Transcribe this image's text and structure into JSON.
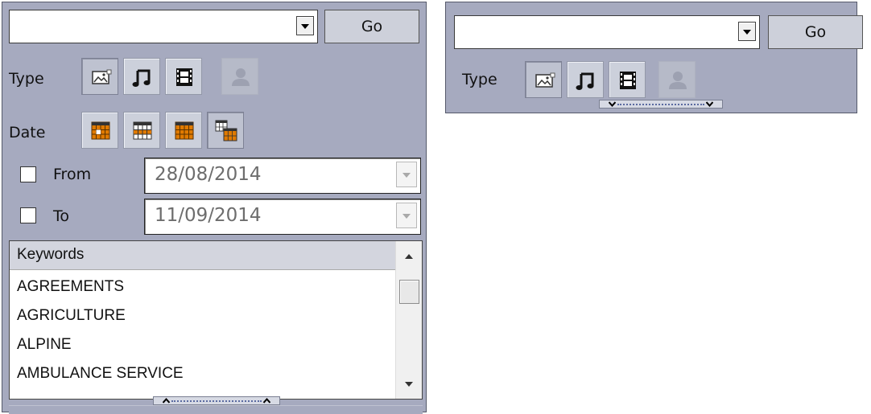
{
  "left_panel": {
    "search": {
      "value": "",
      "go_label": "Go"
    },
    "type_label": "Type",
    "type_buttons": [
      {
        "icon": "image-icon",
        "state": "selected"
      },
      {
        "icon": "music-note-icon",
        "state": "normal"
      },
      {
        "icon": "film-icon",
        "state": "normal"
      },
      {
        "icon": "person-icon",
        "state": "disabled"
      }
    ],
    "date_label": "Date",
    "date_buttons": [
      {
        "icon": "calendar-day-icon",
        "state": "normal"
      },
      {
        "icon": "calendar-week-icon",
        "state": "normal"
      },
      {
        "icon": "calendar-month-icon",
        "state": "normal"
      },
      {
        "icon": "calendar-range-icon",
        "state": "selected"
      }
    ],
    "from": {
      "label": "From",
      "checked": false,
      "value": "28/08/2014"
    },
    "to": {
      "label": "To",
      "checked": false,
      "value": "11/09/2014"
    },
    "keywords": {
      "header": "Keywords",
      "items": [
        "AGREEMENTS",
        "AGRICULTURE",
        "ALPINE",
        "AMBULANCE SERVICE"
      ]
    }
  },
  "right_panel": {
    "search": {
      "value": "",
      "go_label": "Go"
    },
    "type_label": "Type"
  },
  "colors": {
    "panel_bg": "#a6aabf",
    "calendar_orange": "#e07a00",
    "button_bg": "#ccd0db"
  }
}
